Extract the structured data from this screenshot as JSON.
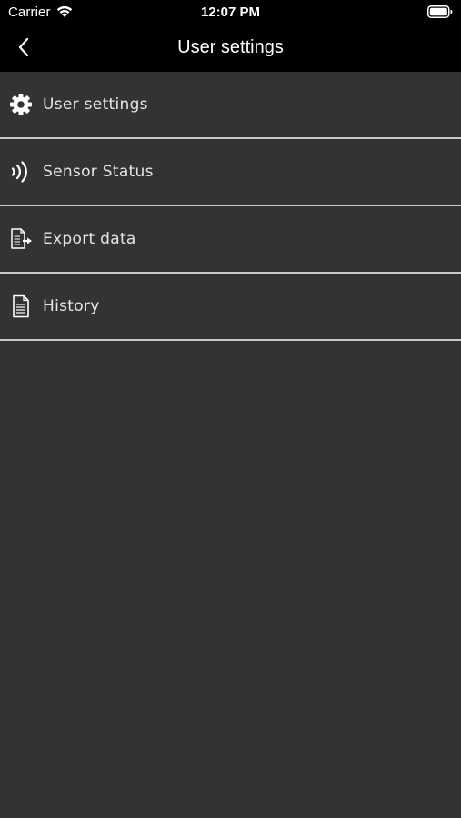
{
  "status_bar": {
    "carrier": "Carrier",
    "time": "12:07 PM",
    "wifi_icon": "wifi-icon",
    "battery_icon": "battery-icon"
  },
  "nav": {
    "title": "User settings",
    "back_icon": "chevron-left-icon"
  },
  "menu": {
    "items": [
      {
        "label": "User settings",
        "icon": "gear-icon"
      },
      {
        "label": "Sensor Status",
        "icon": "signal-waves-icon"
      },
      {
        "label": "Export data",
        "icon": "export-document-icon"
      },
      {
        "label": "History",
        "icon": "document-icon"
      }
    ]
  },
  "colors": {
    "background": "#333333",
    "bar": "#000000",
    "text": "#e6e6e6",
    "divider": "#c8c8c8"
  }
}
